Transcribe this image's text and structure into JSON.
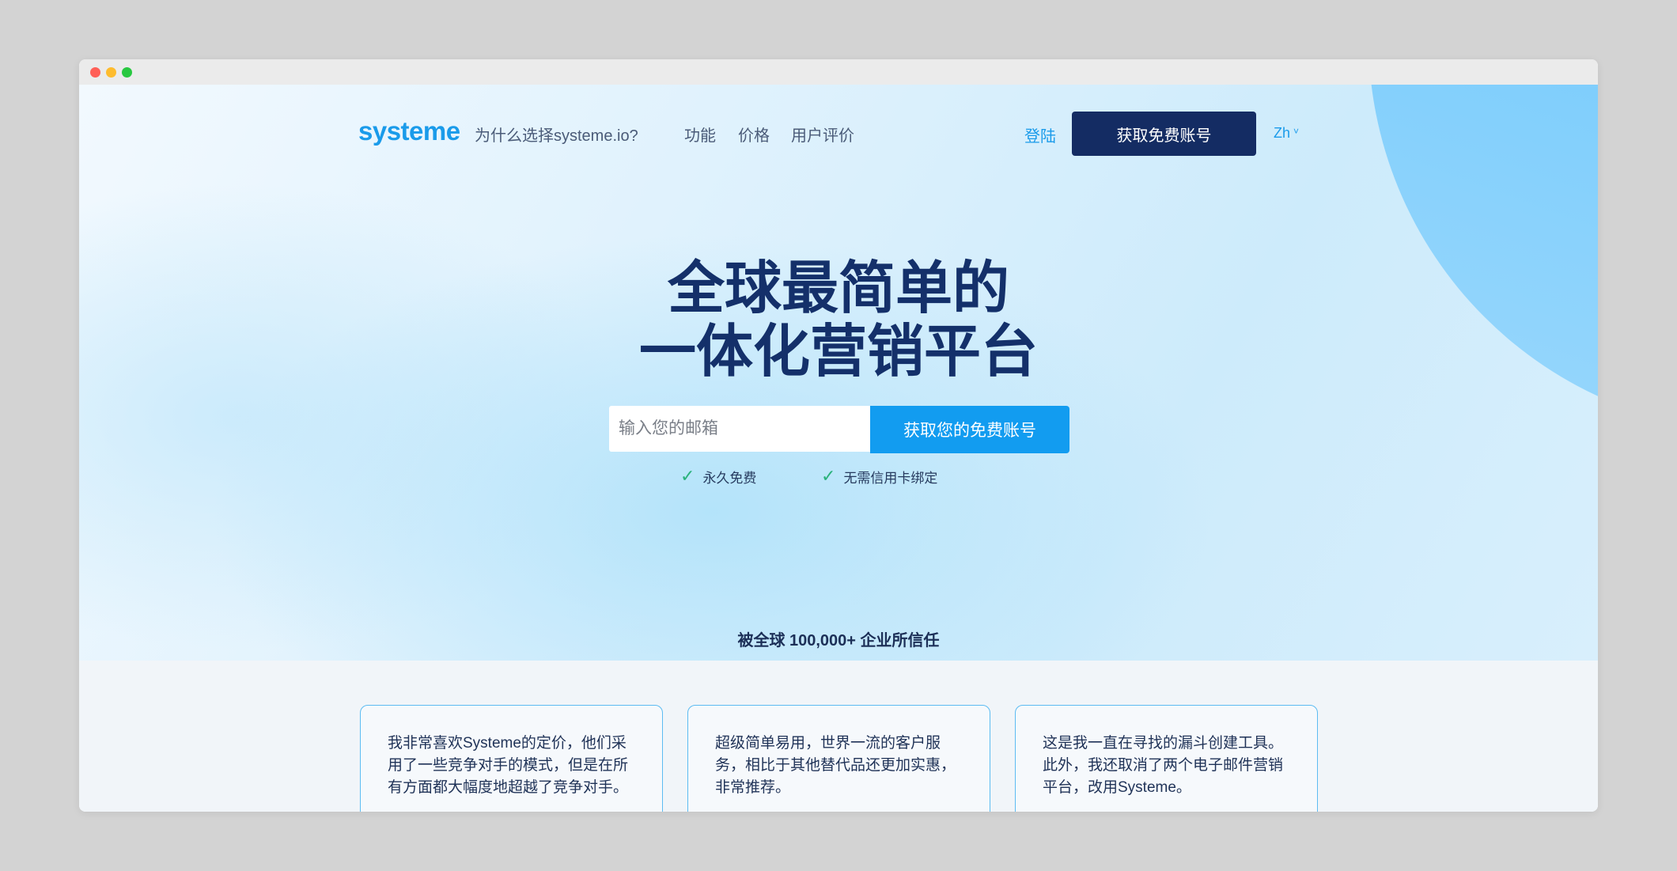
{
  "nav": {
    "logo": "systeme",
    "links": [
      "为什么选择systeme.io?",
      "功能",
      "价格",
      "用户评价"
    ],
    "login": "登陆",
    "cta": "获取免费账号",
    "lang": "Zh"
  },
  "hero": {
    "headline_line1": "全球最简单的",
    "headline_line2": "一体化营销平台",
    "email_placeholder": "输入您的邮箱",
    "cta": "获取您的免费账号",
    "features": [
      "永久免费",
      "无需信用卡绑定"
    ],
    "trust": "被全球 100,000+ 企业所信任"
  },
  "reviews": [
    "我非常喜欢Systeme的定价，他们采用了一些竞争对手的模式，但是在所有方面都大幅度地超越了竞争对手。",
    "超级简单易用，世界一流的客户服务，相比于其他替代品还更加实惠，非常推荐。",
    "这是我一直在寻找的漏斗创建工具。此外，我还取消了两个电子邮件营销平台，改用Systeme。"
  ],
  "colors": {
    "brand_blue": "#1a9bea",
    "navy": "#142c63",
    "cta_blue": "#129cf0",
    "check_green": "#2ab27b"
  },
  "icons": {
    "check": "check-icon",
    "chevron": "chevron-down-icon"
  }
}
